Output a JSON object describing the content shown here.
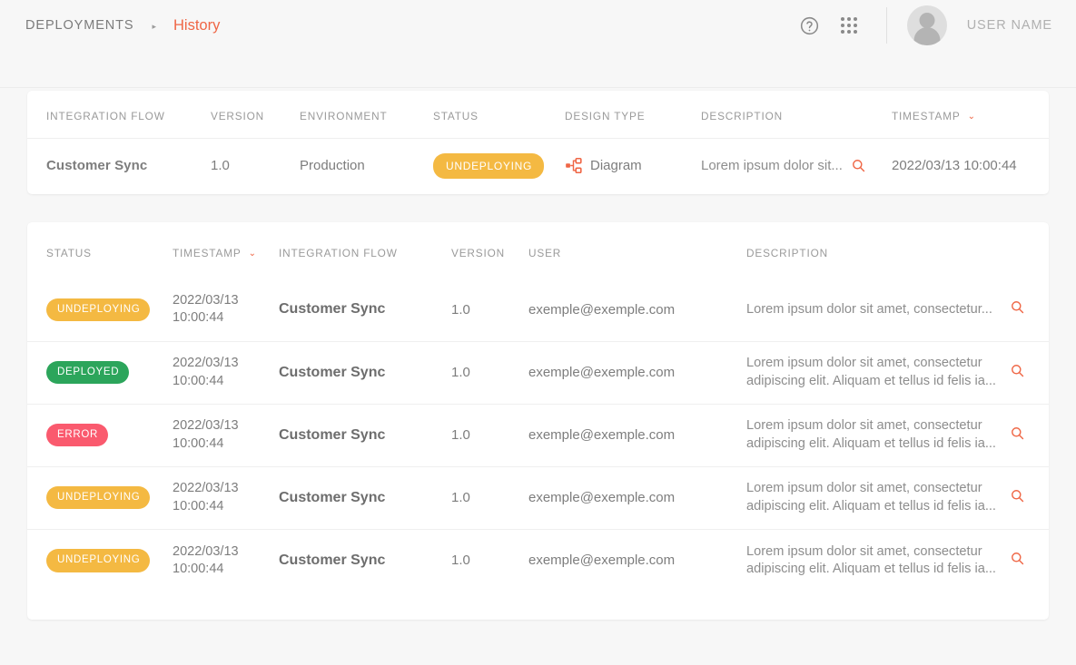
{
  "header": {
    "breadcrumb_root": "DEPLOYMENTS",
    "breadcrumb_separator": "▸",
    "breadcrumb_current": "History",
    "help_icon": "help-circle-icon",
    "apps_icon": "apps-grid-icon",
    "avatar_icon": "user-avatar-icon",
    "username": "USER NAME"
  },
  "colors": {
    "accent": "#ef6645",
    "status_undeploying": "#f4b942",
    "status_deployed": "#2ca55b",
    "status_error": "#fa5a6e",
    "page_background": "#f7f7f7",
    "card_background": "#ffffff"
  },
  "summary": {
    "columns": [
      "INTEGRATION FLOW",
      "VERSION",
      "ENVIRONMENT",
      "STATUS",
      "DESIGN TYPE",
      "DESCRIPTION",
      "TIMESTAMP"
    ],
    "sorted_column": "TIMESTAMP",
    "sort_caret": "⌄",
    "row": {
      "integration_flow": "Customer Sync",
      "version": "1.0",
      "environment": "Production",
      "status": "UNDEPLOYING",
      "design_type": "Diagram",
      "design_type_icon": "account-tree-icon",
      "description": "Lorem ipsum dolor sit...",
      "description_search_icon": "search-icon",
      "timestamp": "2022/03/13 10:00:44"
    }
  },
  "history": {
    "columns": [
      "STATUS",
      "TIMESTAMP",
      "INTEGRATION FLOW",
      "VERSION",
      "USER",
      "DESCRIPTION"
    ],
    "sorted_column": "TIMESTAMP",
    "sort_caret": "⌄",
    "rows": [
      {
        "status": "UNDEPLOYING",
        "status_type": "undeploying",
        "timestamp": "2022/03/13\n10:00:44",
        "integration_flow": "Customer Sync",
        "version": "1.0",
        "user": "exemple@exemple.com",
        "description": "Lorem ipsum dolor sit amet, consectetur...",
        "search_icon": "search-icon"
      },
      {
        "status": "DEPLOYED",
        "status_type": "deployed",
        "timestamp": "2022/03/13\n10:00:44",
        "integration_flow": "Customer Sync",
        "version": "1.0",
        "user": "exemple@exemple.com",
        "description": "Lorem ipsum dolor sit amet, consectetur\nadipiscing elit. Aliquam et tellus id felis ia...",
        "search_icon": "search-icon"
      },
      {
        "status": "ERROR",
        "status_type": "error",
        "timestamp": "2022/03/13\n10:00:44",
        "integration_flow": "Customer Sync",
        "version": "1.0",
        "user": "exemple@exemple.com",
        "description": "Lorem ipsum dolor sit amet, consectetur\nadipiscing elit. Aliquam et tellus id felis ia...",
        "search_icon": "search-icon"
      },
      {
        "status": "UNDEPLOYING",
        "status_type": "undeploying",
        "timestamp": "2022/03/13\n10:00:44",
        "integration_flow": "Customer Sync",
        "version": "1.0",
        "user": "exemple@exemple.com",
        "description": "Lorem ipsum dolor sit amet, consectetur\nadipiscing elit. Aliquam et tellus id felis ia...",
        "search_icon": "search-icon"
      },
      {
        "status": "UNDEPLOYING",
        "status_type": "undeploying",
        "timestamp": "2022/03/13\n10:00:44",
        "integration_flow": "Customer Sync",
        "version": "1.0",
        "user": "exemple@exemple.com",
        "description": "Lorem ipsum dolor sit amet, consectetur\nadipiscing elit. Aliquam et tellus id felis ia...",
        "search_icon": "search-icon"
      }
    ]
  }
}
